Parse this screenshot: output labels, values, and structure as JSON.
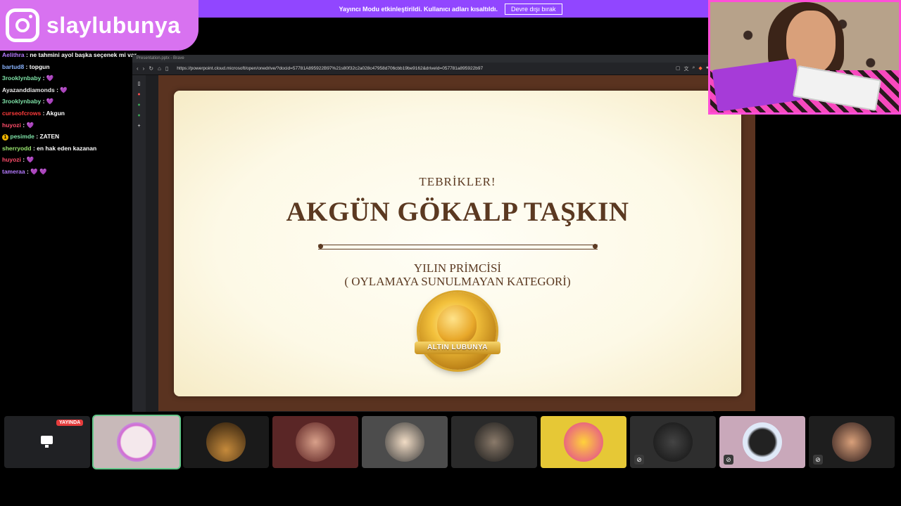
{
  "banner": {
    "message": "Yayıncı Modu etkinleştirildi. Kullanıcı adları kısaltıldı.",
    "disable_label": "Devre dışı bırak"
  },
  "logo": {
    "name": "slaylubunya"
  },
  "chat": {
    "messages": [
      {
        "user": "Aelithra",
        "text": "ne tahmini ayol başka seçenek mi var",
        "color": "#b57aff"
      },
      {
        "user": "bartud8",
        "text": "topgun",
        "color": "#8ab4ff"
      },
      {
        "user": "3rooklynbaby",
        "text": "💜",
        "color": "#7fe3a8"
      },
      {
        "user": "Ayazanddiamonds",
        "text": "💜",
        "color": "#e8e8e8"
      },
      {
        "user": "3rooklynbaby",
        "text": "💜",
        "color": "#7fe3a8"
      },
      {
        "user": "curseofcrows",
        "text": "Akgun",
        "color": "#ff3b3b"
      },
      {
        "user": "huyozi",
        "text": "💜",
        "color": "#ff4d6a"
      },
      {
        "user": "pesimde",
        "text": "ZATEN",
        "color": "#7fe3a8",
        "badge": "1"
      },
      {
        "user": "sherryodd",
        "text": "en hak eden kazanan",
        "color": "#9be870"
      },
      {
        "user": "huyozi",
        "text": "💜",
        "color": "#ff4d6a"
      },
      {
        "user": "tameraa",
        "text": "💜 💜",
        "color": "#b57aff"
      }
    ]
  },
  "browser": {
    "tab_title": "Presentation.pptx - Brave",
    "url": "https://powerpoint.cloud.microsoft/open/onedrive/?docid=57781A895922B97%21s80f32c2a028c47958d706cbb19be9162&driveId=057781a895922b97"
  },
  "slide": {
    "heading": "TEBRİKLER!",
    "winner": "AKGÜN GÖKALP TAŞKIN",
    "award_line1": "YILIN PRİMCİSİ",
    "award_line2": "( OYLAMAYA SUNULMAYAN KATEGORİ)",
    "badge_text": "ALTIN LUBUNYA"
  },
  "tiles": {
    "live_label": "YAYINDA",
    "count": 10
  },
  "colors": {
    "accent": "#9146ff",
    "logo_bg": "#d872f0",
    "slide_text": "#5b3921",
    "webcam_border": "#ff4fd8"
  }
}
